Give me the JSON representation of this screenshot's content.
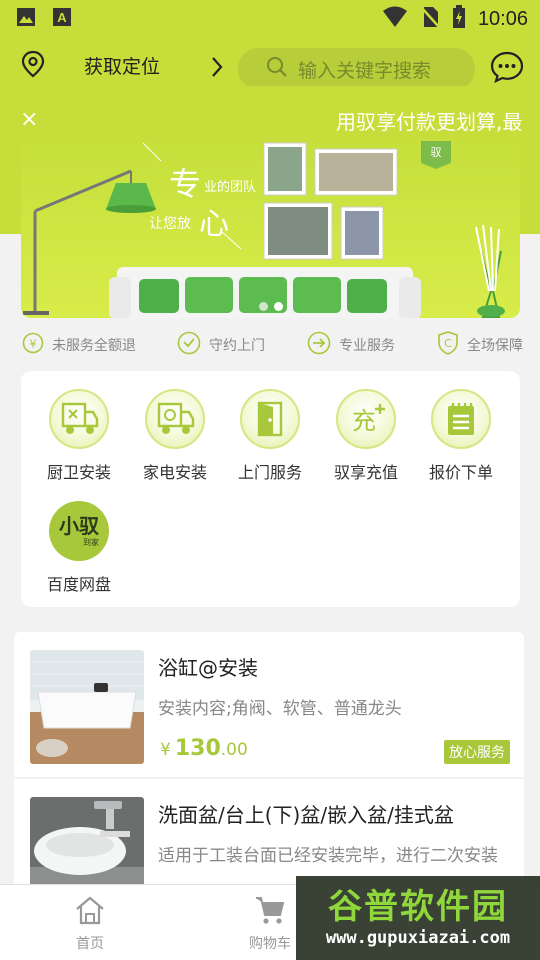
{
  "status_bar": {
    "time": "10:06"
  },
  "header": {
    "location_label": "获取定位",
    "search_placeholder": "输入关键字搜索"
  },
  "notice": {
    "close": "×",
    "text": "用驭享付款更划算,最"
  },
  "banner": {
    "slogan_big_1": "专",
    "slogan_small_1": "业的团队",
    "slogan_small_2": "让您放",
    "slogan_big_2": "心",
    "badge": "驭",
    "active_dot": 2,
    "dot_count": 2
  },
  "features": [
    {
      "icon": "yen-circle-icon",
      "label": "未服务全额退"
    },
    {
      "icon": "check-circle-icon",
      "label": "守约上门"
    },
    {
      "icon": "arrow-circle-icon",
      "label": "专业服务"
    },
    {
      "icon": "shield-c-icon",
      "label": "全场保障"
    }
  ],
  "services": [
    {
      "icon": "kitchen-truck-icon",
      "label": "厨卫安装"
    },
    {
      "icon": "appliance-truck-icon",
      "label": "家电安装"
    },
    {
      "icon": "door-icon",
      "label": "上门服务"
    },
    {
      "icon": "recharge-icon",
      "label": "驭享充值",
      "icon_text": "充"
    },
    {
      "icon": "notepad-icon",
      "label": "报价下单"
    },
    {
      "icon": "xiaoyu-logo-icon",
      "label": "百度网盘",
      "logo_text": "小驭",
      "logo_sub": "到家"
    }
  ],
  "products": [
    {
      "title": "浴缸@安装",
      "desc": "安装内容;角阀、软管、普通龙头",
      "currency": "¥",
      "price_int": "130",
      "price_dec": ".00",
      "tag": "放心服务"
    },
    {
      "title": "洗面盆/台上(下)盆/嵌入盆/挂式盆",
      "desc": "适用于工装台面已经安装完毕，进行二次安装"
    }
  ],
  "tabbar": [
    {
      "icon": "home-icon",
      "label": "首页"
    },
    {
      "icon": "cart-icon",
      "label": "购物车"
    }
  ],
  "watermark": {
    "title": "谷普软件园",
    "url": "www.gupuxiazai.com"
  },
  "colors": {
    "brand": "#c6dd3a",
    "accent": "#a8c83c"
  }
}
